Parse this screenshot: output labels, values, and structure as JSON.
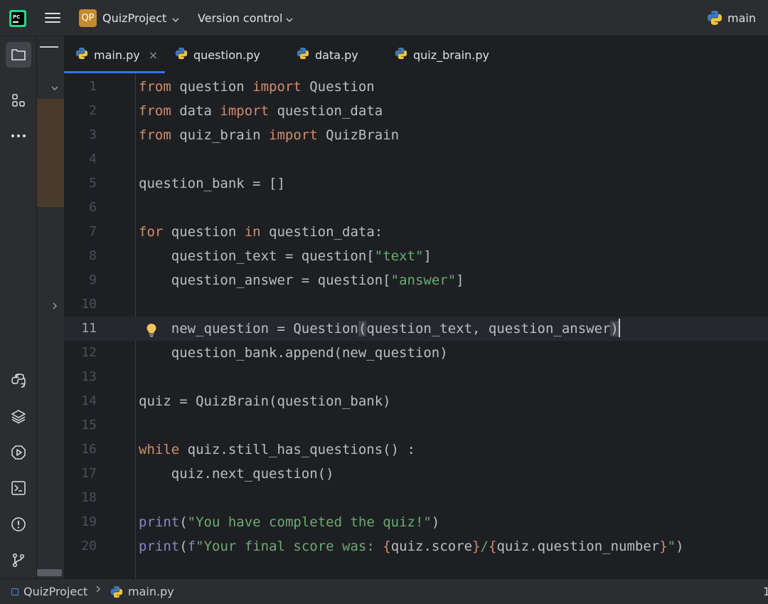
{
  "titlebar": {
    "project_badge": "QP",
    "project_name": "QuizProject",
    "vcs_label": "Version control",
    "branch": "main"
  },
  "tabs": [
    {
      "label": "main.py",
      "active": true
    },
    {
      "label": "question.py"
    },
    {
      "label": "data.py"
    },
    {
      "label": "quiz_brain.py"
    }
  ],
  "tab_close_glyph": "×",
  "editor": {
    "current_line": 11,
    "lines": [
      {
        "n": "1"
      },
      {
        "n": "2"
      },
      {
        "n": "3"
      },
      {
        "n": "4"
      },
      {
        "n": "5"
      },
      {
        "n": "6"
      },
      {
        "n": "7"
      },
      {
        "n": "8"
      },
      {
        "n": "9"
      },
      {
        "n": "10"
      },
      {
        "n": "11"
      },
      {
        "n": "12"
      },
      {
        "n": "13"
      },
      {
        "n": "14"
      },
      {
        "n": "15"
      },
      {
        "n": "16"
      },
      {
        "n": "17"
      },
      {
        "n": "18"
      },
      {
        "n": "19"
      },
      {
        "n": "20"
      }
    ],
    "code": [
      "from question import Question",
      "from data import question_data",
      "from quiz_brain import QuizBrain",
      "",
      "question_bank = []",
      "",
      "for question in question_data:",
      "    question_text = question[\"text\"]",
      "    question_answer = question[\"answer\"]",
      "",
      "    new_question = Question(question_text, question_answer)",
      "    question_bank.append(new_question)",
      "",
      "quiz = QuizBrain(question_bank)",
      "",
      "while quiz.still_has_questions() :",
      "    quiz.next_question()",
      "",
      "print(\"You have completed the quiz!\")",
      "print(f\"Your final score was: {quiz.score}/{quiz.question_number}\")"
    ]
  },
  "statusbar": {
    "project": "QuizProject",
    "separator": ">",
    "file": "main.py",
    "right_edge": "1"
  },
  "colors": {
    "keyword": "#cf8e6d",
    "builtin": "#8888c6",
    "string": "#6aab73",
    "accent": "#3574f0",
    "project_badge": "#c48a2c"
  },
  "icons": {
    "app": "pycharm-logo-icon",
    "menu": "hamburger-menu-icon",
    "branch": "python-interpreter-icon",
    "tools": [
      "project-folder-icon",
      "structure-icon",
      "more-icon",
      "python-console-icon",
      "layers-icon",
      "services-icon",
      "terminal-icon",
      "problems-icon",
      "git-icon"
    ]
  }
}
